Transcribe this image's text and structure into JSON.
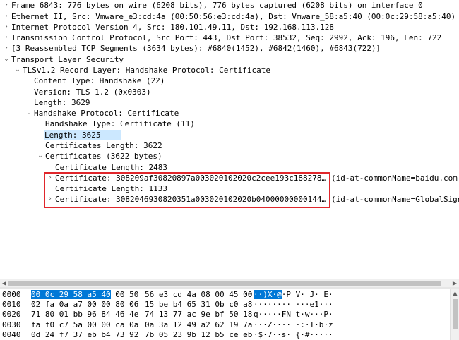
{
  "tree": [
    {
      "indent": 0,
      "arrow": "›",
      "text": "Frame 6843: 776 bytes on wire (6208 bits), 776 bytes captured (6208 bits) on interface 0"
    },
    {
      "indent": 0,
      "arrow": "›",
      "text": "Ethernet II, Src: Vmware_e3:cd:4a (00:50:56:e3:cd:4a), Dst: Vmware_58:a5:40 (00:0c:29:58:a5:40)"
    },
    {
      "indent": 0,
      "arrow": "›",
      "text": "Internet Protocol Version 4, Src: 180.101.49.11, Dst: 192.168.113.128"
    },
    {
      "indent": 0,
      "arrow": "›",
      "text": "Transmission Control Protocol, Src Port: 443, Dst Port: 38532, Seq: 2992, Ack: 196, Len: 722"
    },
    {
      "indent": 0,
      "arrow": "›",
      "text": "[3 Reassembled TCP Segments (3634 bytes): #6840(1452), #6842(1460), #6843(722)]"
    },
    {
      "indent": 0,
      "arrow": "⌄",
      "text": "Transport Layer Security"
    },
    {
      "indent": 1,
      "arrow": "⌄",
      "text": "TLSv1.2 Record Layer: Handshake Protocol: Certificate"
    },
    {
      "indent": 2,
      "arrow": "",
      "text": "Content Type: Handshake (22)"
    },
    {
      "indent": 2,
      "arrow": "",
      "text": "Version: TLS 1.2 (0x0303)"
    },
    {
      "indent": 2,
      "arrow": "",
      "text": "Length: 3629"
    },
    {
      "indent": 2,
      "arrow": "⌄",
      "text": "Handshake Protocol: Certificate"
    },
    {
      "indent": 3,
      "arrow": "",
      "text": "Handshake Type: Certificate (11)"
    },
    {
      "indent": 3,
      "arrow": "",
      "text": "Length: 3625",
      "selected": true
    },
    {
      "indent": 3,
      "arrow": "",
      "text": "Certificates Length: 3622"
    },
    {
      "indent": 3,
      "arrow": "⌄",
      "text": "Certificates (3622 bytes)"
    },
    {
      "indent": 4,
      "arrow": "",
      "text": "Certificate Length: 2483"
    },
    {
      "indent": 4,
      "arrow": "›",
      "text": "Certificate: 308209af30820897a003020102020c2cee193c188278ea3e…",
      "extra": "(id-at-commonName=baidu.com,id-at-org",
      "boxed": true
    },
    {
      "indent": 4,
      "arrow": "",
      "text": "Certificate Length: 1133"
    },
    {
      "indent": 4,
      "arrow": "›",
      "text": "Certificate: 3082046930820351a003020102020b040000000001444ef0…",
      "extra": "(id-at-commonName=GlobalSign Organiza",
      "boxed": true
    }
  ],
  "bytes": [
    {
      "off": "0000",
      "h1": "00 0c 29 58 a5 40",
      "h1b": " 00 50",
      "h2": "56 e3 cd 4a 08 00 45 00",
      "ascA": "··)X·@",
      "ascB": "·P V· J· E·"
    },
    {
      "off": "0010",
      "h1": "",
      "h1b": "02 fa 0a a7 00 00 80 06",
      "h2": "15 be b4 65 31 0b c0 a8",
      "ascA": "",
      "ascB": "········ ···e1···"
    },
    {
      "off": "0020",
      "h1": "",
      "h1b": "71 80 01 bb 96 84 46 4e",
      "h2": "74 13 77 ac 9e bf 50 18",
      "ascA": "",
      "ascB": "q·····FN t·w···P·"
    },
    {
      "off": "0030",
      "h1": "",
      "h1b": "fa f0 c7 5a 00 00 ca 0a",
      "h2": "0a 3a 12 49 a2 62 19 7a",
      "ascA": "",
      "ascB": "···Z···· ·:·I·b·z"
    },
    {
      "off": "0040",
      "h1": "",
      "h1b": "0d 24 f7 37 eb b4 73 92",
      "h2": "7b 05 23 9b 12 b5 ce eb",
      "ascA": "",
      "ascB": "·$·7··s· {·#·····"
    }
  ]
}
